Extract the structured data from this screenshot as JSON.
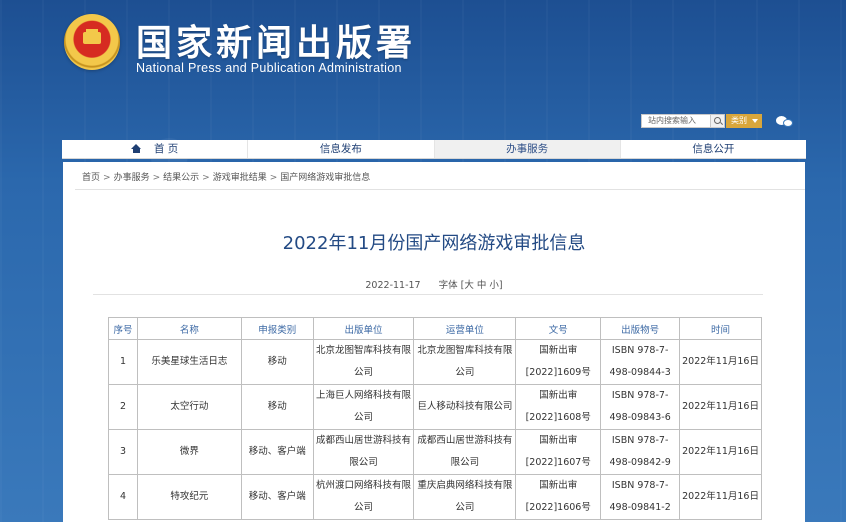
{
  "site": {
    "title_cn": "国家新闻出版署",
    "title_en": "National Press and Publication Administration"
  },
  "search": {
    "placeholder": "站内搜索输入",
    "category": "类别"
  },
  "nav": {
    "items": [
      {
        "label": "首 页",
        "icon": "home-icon",
        "active": false
      },
      {
        "label": "信息发布",
        "active": false
      },
      {
        "label": "办事服务",
        "active": true
      },
      {
        "label": "信息公开",
        "active": false
      }
    ]
  },
  "breadcrumb": [
    "首页",
    "办事服务",
    "结果公示",
    "游戏审批结果",
    "国产网络游戏审批信息"
  ],
  "breadcrumb_separator": ">",
  "article": {
    "title": "2022年11月份国产网络游戏审批信息",
    "date": "2022-11-17",
    "font_label": "字体 [大 中 小]"
  },
  "table": {
    "headers": [
      "序号",
      "名称",
      "申报类别",
      "出版单位",
      "运营单位",
      "文号",
      "出版物号",
      "时间"
    ],
    "rows": [
      {
        "idx": "1",
        "name": "乐美星球生活日志",
        "type": "移动",
        "publisher": "北京龙图智库科技有限公司",
        "operator": "北京龙图智库科技有限公司",
        "doc": "国新出审[2022]1609号",
        "isbn": "ISBN 978-7-498-09844-3",
        "time": "2022年11月16日"
      },
      {
        "idx": "2",
        "name": "太空行动",
        "type": "移动",
        "publisher": "上海巨人网络科技有限公司",
        "operator": "巨人移动科技有限公司",
        "doc": "国新出审[2022]1608号",
        "isbn": "ISBN 978-7-498-09843-6",
        "time": "2022年11月16日"
      },
      {
        "idx": "3",
        "name": "微界",
        "type": "移动、客户端",
        "publisher": "成都西山居世游科技有限公司",
        "operator": "成都西山居世游科技有限公司",
        "doc": "国新出审[2022]1607号",
        "isbn": "ISBN 978-7-498-09842-9",
        "time": "2022年11月16日"
      },
      {
        "idx": "4",
        "name": "特攻纪元",
        "type": "移动、客户端",
        "publisher": "杭州渡口网络科技有限公司",
        "operator": "重庆启典网络科技有限公司",
        "doc": "国新出审[2022]1606号",
        "isbn": "ISBN 978-7-498-09841-2",
        "time": "2022年11月16日"
      }
    ]
  },
  "colors": {
    "header_blue": "#2b68ad",
    "title_blue": "#234a84",
    "th_blue": "#3d6aa5"
  }
}
